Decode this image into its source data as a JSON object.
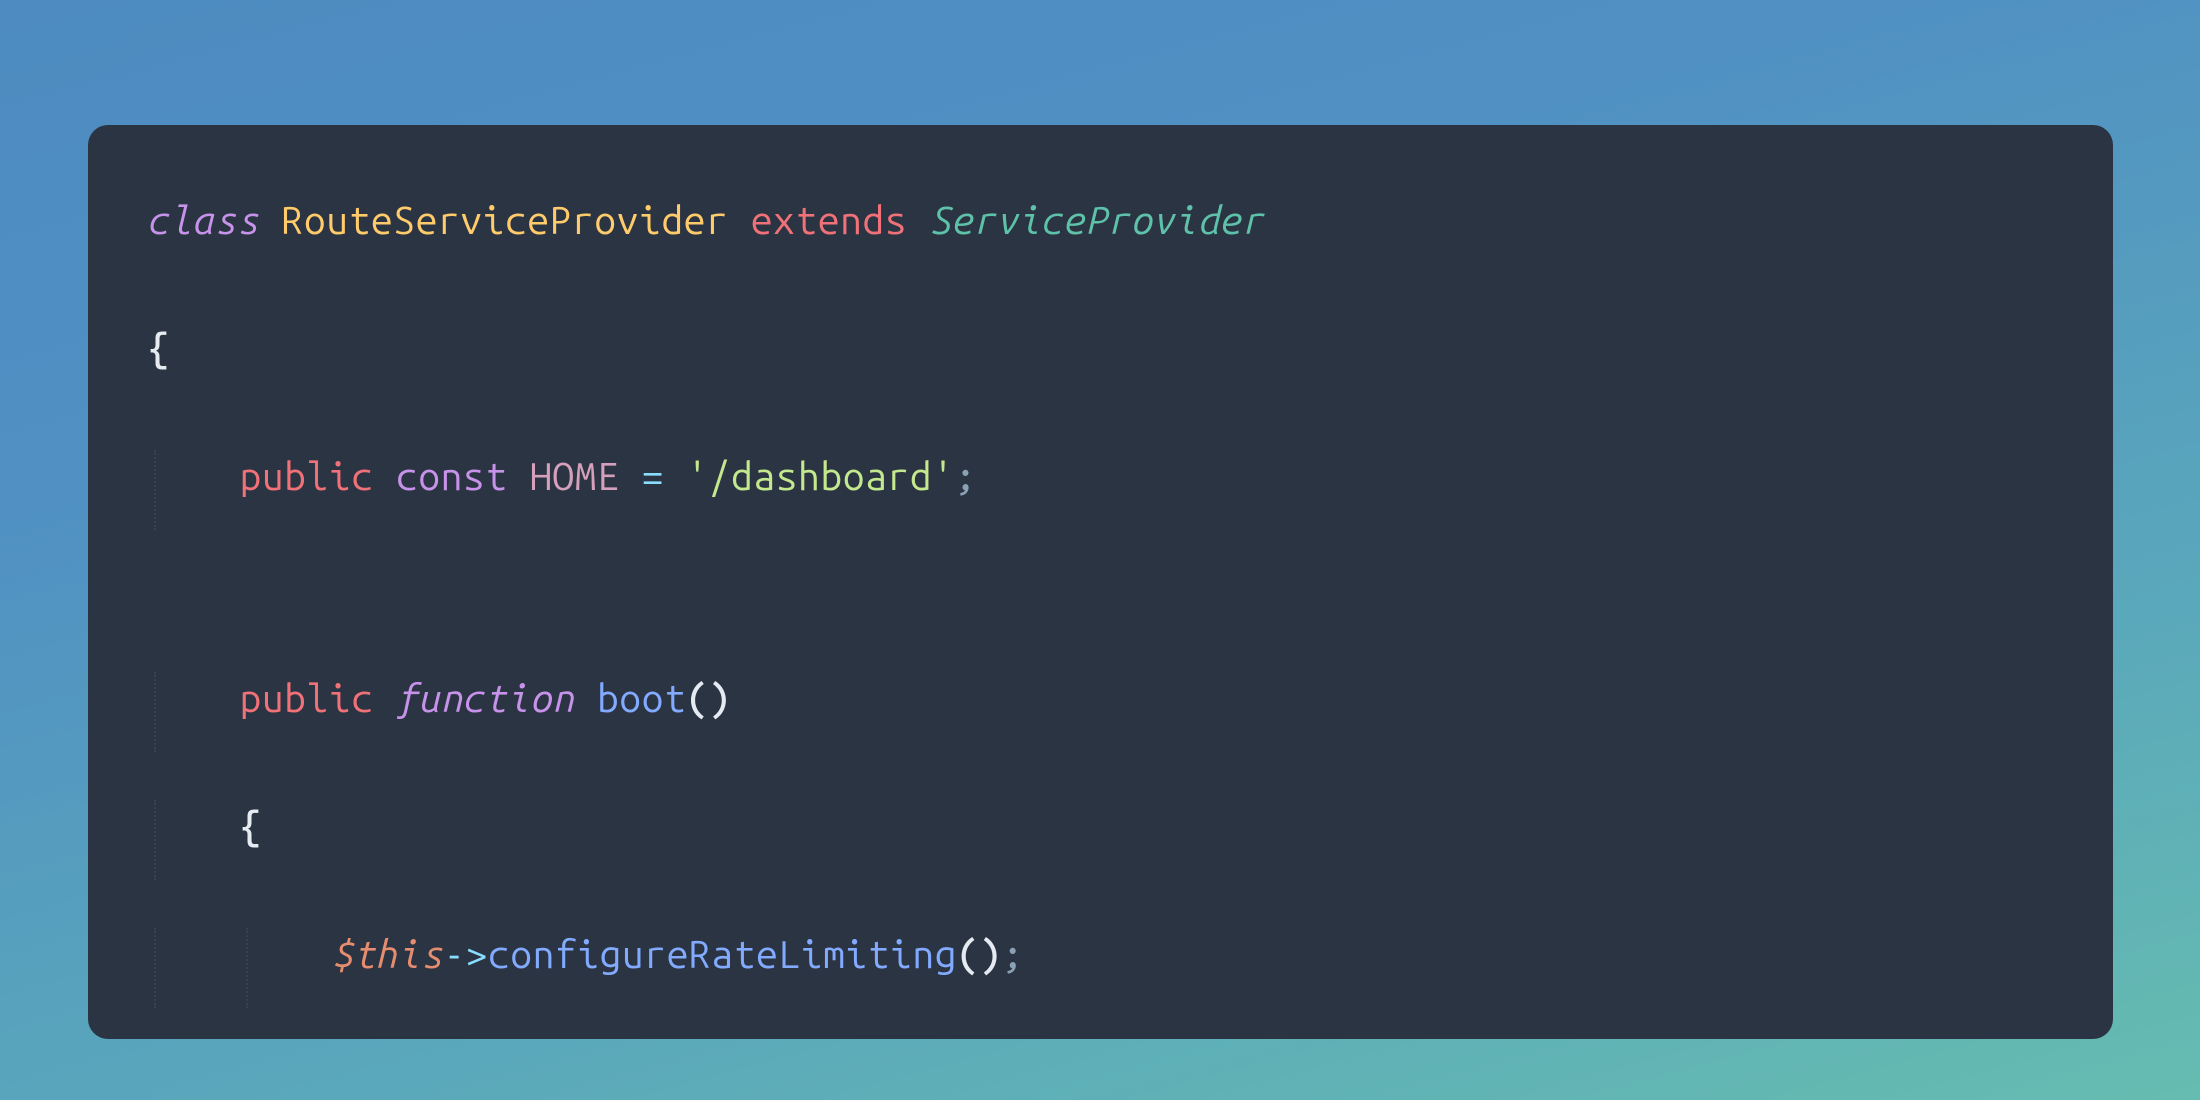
{
  "code": {
    "line1": {
      "class_keyword": "class",
      "class_name": "RouteServiceProvider",
      "extends_keyword": "extends",
      "parent_class": "ServiceProvider"
    },
    "line2": {
      "brace_open": "{"
    },
    "line3": {
      "modifier": "public",
      "const_keyword": "const",
      "constant_name": "HOME",
      "equals": "=",
      "string_value": "'/dashboard'",
      "semicolon": ";"
    },
    "line4": {
      "modifier": "public",
      "function_keyword": "function",
      "method_name": "boot",
      "parens": "()"
    },
    "line5": {
      "brace_open": "{"
    },
    "line6": {
      "variable": "$this",
      "arrow": "->",
      "method_call": "configureRateLimiting",
      "parens": "()",
      "semicolon": ";"
    }
  },
  "colors": {
    "background_gradient_start": "#4d8bc0",
    "background_gradient_end": "#66bcb0",
    "editor_background": "#2b3442",
    "keyword_purple": "#c792ea",
    "type_yellow": "#ffcb6b",
    "modifier_red": "#f07178",
    "type_teal": "#5ec2aa",
    "string_green": "#c3e88d",
    "method_blue": "#82aaff",
    "variable_orange": "#e78d6f",
    "operator_cyan": "#89ddff",
    "brace_white": "#e6ebf1"
  }
}
